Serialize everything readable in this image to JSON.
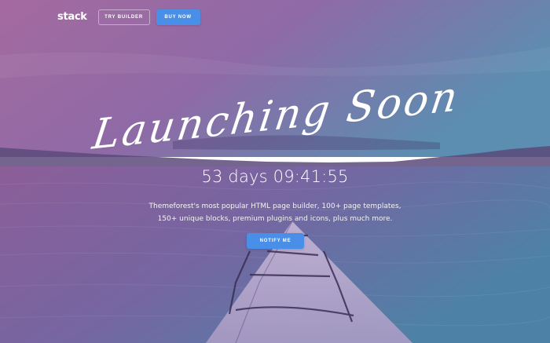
{
  "brand": {
    "logo": "stack"
  },
  "nav": {
    "try_builder_label": "TRY BUILDER",
    "buy_now_label": "BUY NOW"
  },
  "hero": {
    "headline": "Launching Soon",
    "countdown": "53 days 09:41:55",
    "tagline_line1": "Themeforest's most popular HTML page builder, 100+ page templates,",
    "tagline_line2": "150+ unique blocks, premium plugins and icons, plus much more.",
    "notify_label": "NOTIFY ME"
  },
  "colors": {
    "overlay_left": "#8e5a96",
    "overlay_right": "#4f86a6",
    "button_blue": "#4a8fe7"
  }
}
